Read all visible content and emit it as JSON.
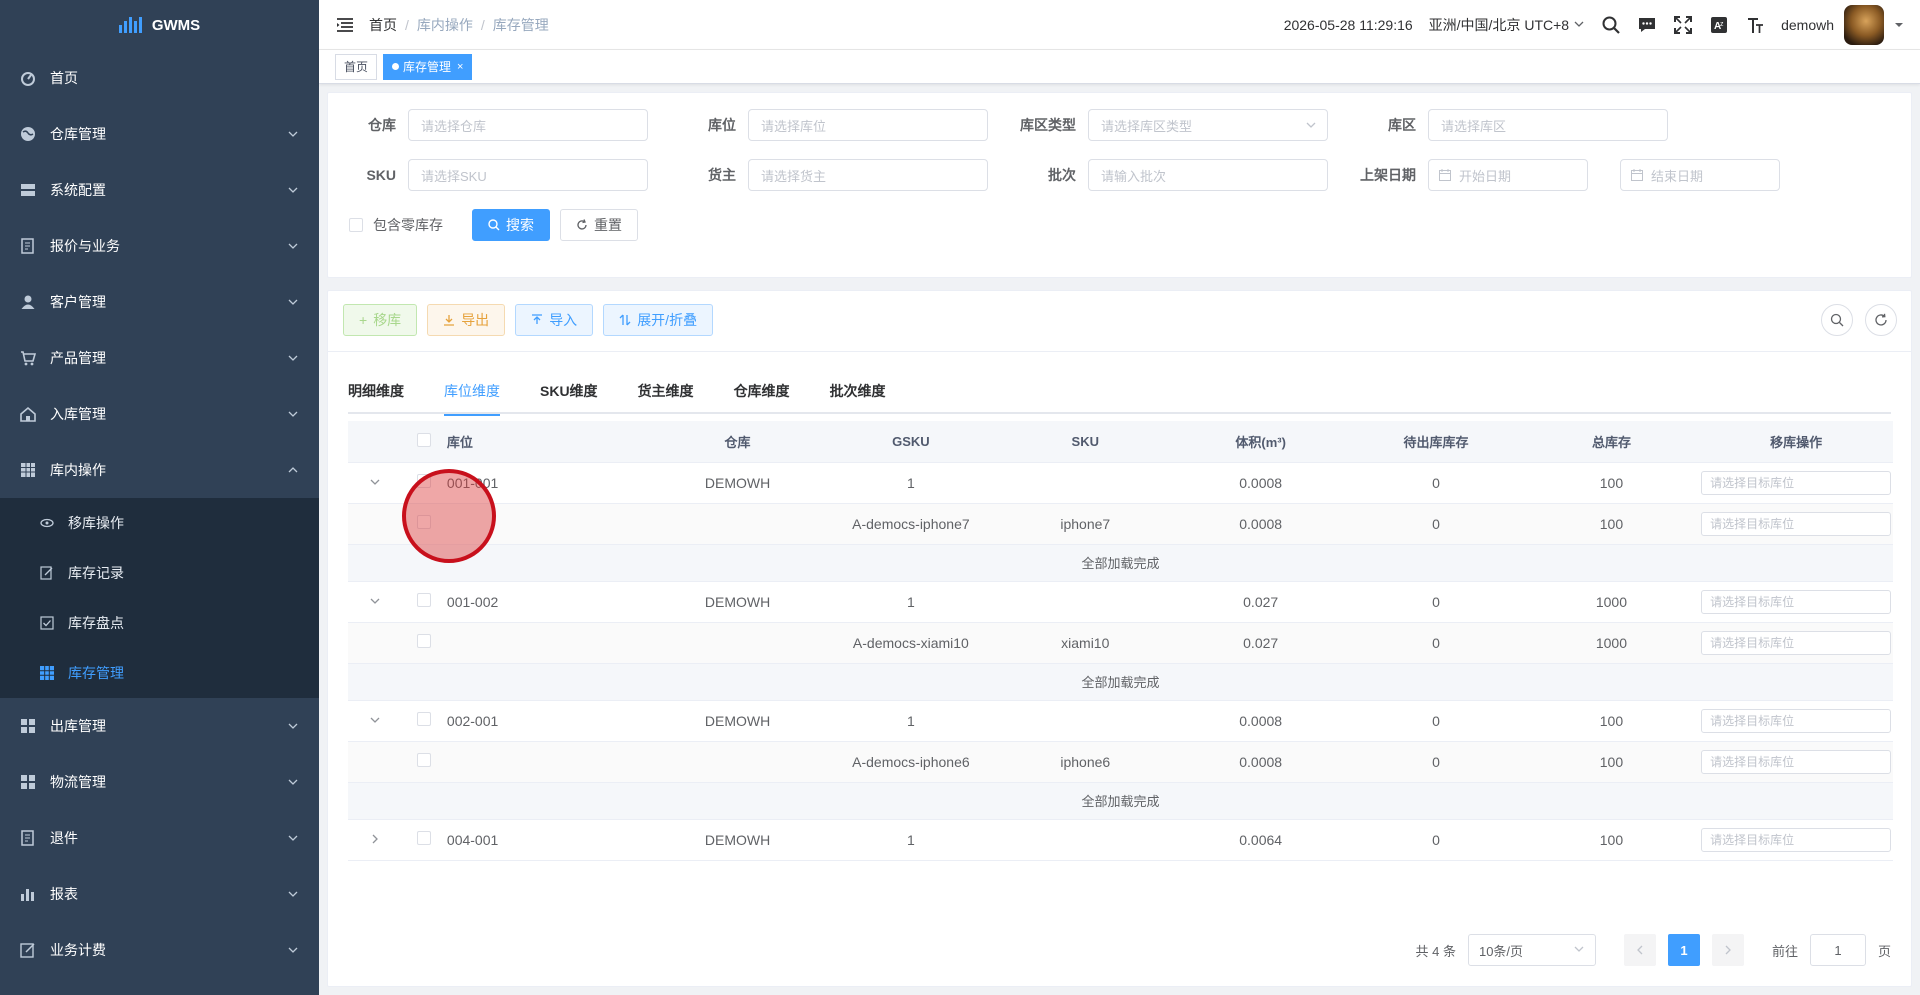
{
  "app": {
    "name": "GWMS"
  },
  "sidebar": {
    "items": [
      {
        "label": "首页",
        "icon": "dashboard-icon"
      },
      {
        "label": "仓库管理",
        "icon": "globe-icon"
      },
      {
        "label": "系统配置",
        "icon": "server-icon"
      },
      {
        "label": "报价与业务",
        "icon": "document-icon"
      },
      {
        "label": "客户管理",
        "icon": "user-icon"
      },
      {
        "label": "产品管理",
        "icon": "cart-icon"
      },
      {
        "label": "入库管理",
        "icon": "home-icon"
      },
      {
        "label": "库内操作",
        "icon": "table-icon"
      },
      {
        "label": "出库管理",
        "icon": "grid-icon"
      },
      {
        "label": "物流管理",
        "icon": "grid-icon"
      },
      {
        "label": "退件",
        "icon": "document-icon"
      },
      {
        "label": "报表",
        "icon": "chart-icon"
      },
      {
        "label": "业务计费",
        "icon": "edit-icon"
      }
    ],
    "sub_items": [
      {
        "label": "移库操作",
        "icon": "eye-icon"
      },
      {
        "label": "库存记录",
        "icon": "edit-icon"
      },
      {
        "label": "库存盘点",
        "icon": "checkbox-icon"
      },
      {
        "label": "库存管理",
        "icon": "table-icon"
      }
    ]
  },
  "header": {
    "breadcrumb": [
      "首页",
      "库内操作",
      "库存管理"
    ],
    "datetime": "2026-05-28 11:29:16",
    "timezone": "亚洲/中国/北京 UTC+8",
    "username": "demowh"
  },
  "tags": {
    "home": "首页",
    "current": "库存管理"
  },
  "search": {
    "labels": {
      "warehouse": "仓库",
      "location": "库位",
      "zone_type": "库区类型",
      "zone": "库区",
      "sku": "SKU",
      "owner": "货主",
      "batch": "批次",
      "shelf_date": "上架日期"
    },
    "placeholders": {
      "warehouse": "请选择仓库",
      "location": "请选择库位",
      "zone_type": "请选择库区类型",
      "zone": "请选择库区",
      "sku": "请选择SKU",
      "owner": "请选择货主",
      "batch": "请输入批次",
      "start_date": "开始日期",
      "end_date": "结束日期"
    },
    "include_zero": "包含零库存",
    "search_btn": "搜索",
    "reset_btn": "重置"
  },
  "toolbar": {
    "move": "移库",
    "export": "导出",
    "import": "导入",
    "expand": "展开/折叠"
  },
  "tabs": [
    "明细维度",
    "库位维度",
    "SKU维度",
    "货主维度",
    "仓库维度",
    "批次维度"
  ],
  "table": {
    "columns": [
      "库位",
      "仓库",
      "GSKU",
      "SKU",
      "体积(m³)",
      "待出库库存",
      "总库存",
      "移库操作"
    ],
    "target_placeholder": "请选择目标库位",
    "loaded_text": "全部加载完成",
    "groups": [
      {
        "location": "001-001",
        "warehouse": "DEMOWH",
        "gsku": "1",
        "volume": "0.0008",
        "pending": "0",
        "total": "100",
        "child": {
          "gsku": "A-democs-iphone7",
          "sku": "iphone7",
          "volume": "0.0008",
          "pending": "0",
          "total": "100"
        }
      },
      {
        "location": "001-002",
        "warehouse": "DEMOWH",
        "gsku": "1",
        "volume": "0.027",
        "pending": "0",
        "total": "1000",
        "child": {
          "gsku": "A-democs-xiami10",
          "sku": "xiami10",
          "volume": "0.027",
          "pending": "0",
          "total": "1000"
        }
      },
      {
        "location": "002-001",
        "warehouse": "DEMOWH",
        "gsku": "1",
        "volume": "0.0008",
        "pending": "0",
        "total": "100",
        "child": {
          "gsku": "A-democs-iphone6",
          "sku": "iphone6",
          "volume": "0.0008",
          "pending": "0",
          "total": "100"
        }
      },
      {
        "location": "004-001",
        "warehouse": "DEMOWH",
        "gsku": "1",
        "volume": "0.0064",
        "pending": "0",
        "total": "100"
      }
    ]
  },
  "pagination": {
    "total": "共 4 条",
    "page_size": "10条/页",
    "current": "1",
    "goto": "前往",
    "page_unit": "页",
    "goto_value": "1"
  },
  "colors": {
    "sidebar": "#304156",
    "submenu": "#1f2d3d",
    "primary": "#409eff"
  }
}
